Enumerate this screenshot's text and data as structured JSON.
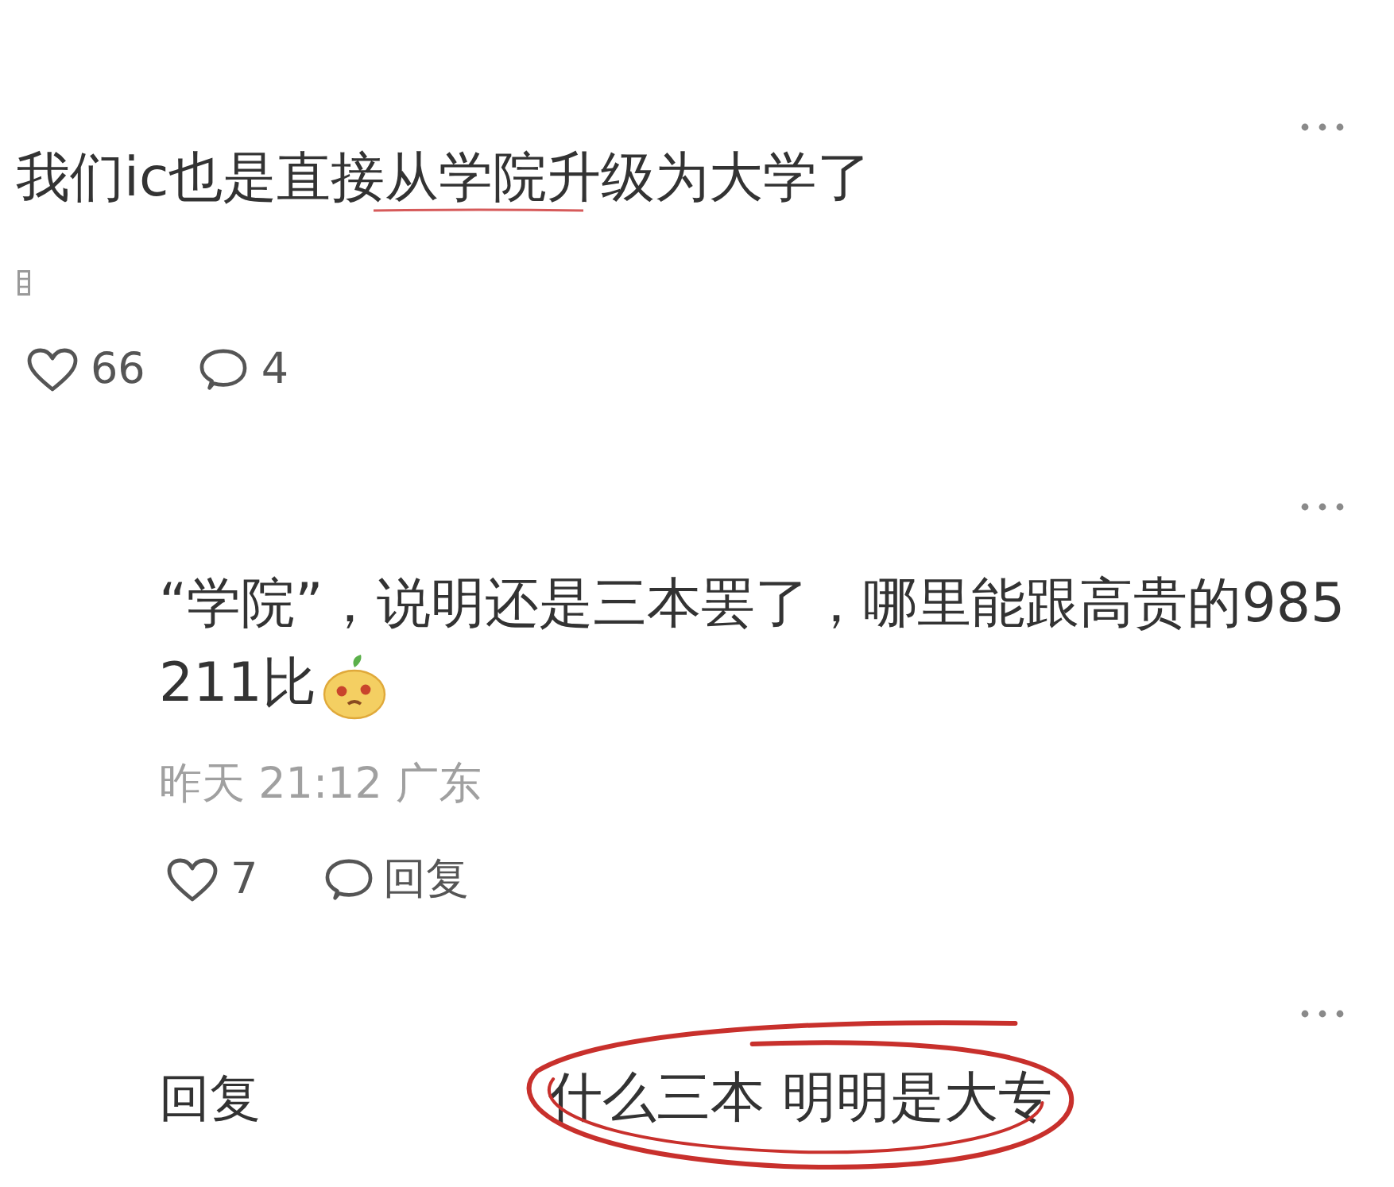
{
  "comment": {
    "text": "我们ic也是直接从学院升级为大学了",
    "likes": "66",
    "replies": "4"
  },
  "reply": {
    "text_lines": [
      "“学院”，说明还是三本罢了，哪里能跟高贵的985",
      "211比"
    ],
    "meta": "昨天 21:12 广东",
    "likes": "7",
    "reply_label": "回复"
  },
  "reply_row": {
    "label": "回复",
    "text": "什么三本 明明是大专",
    "circled": true
  }
}
